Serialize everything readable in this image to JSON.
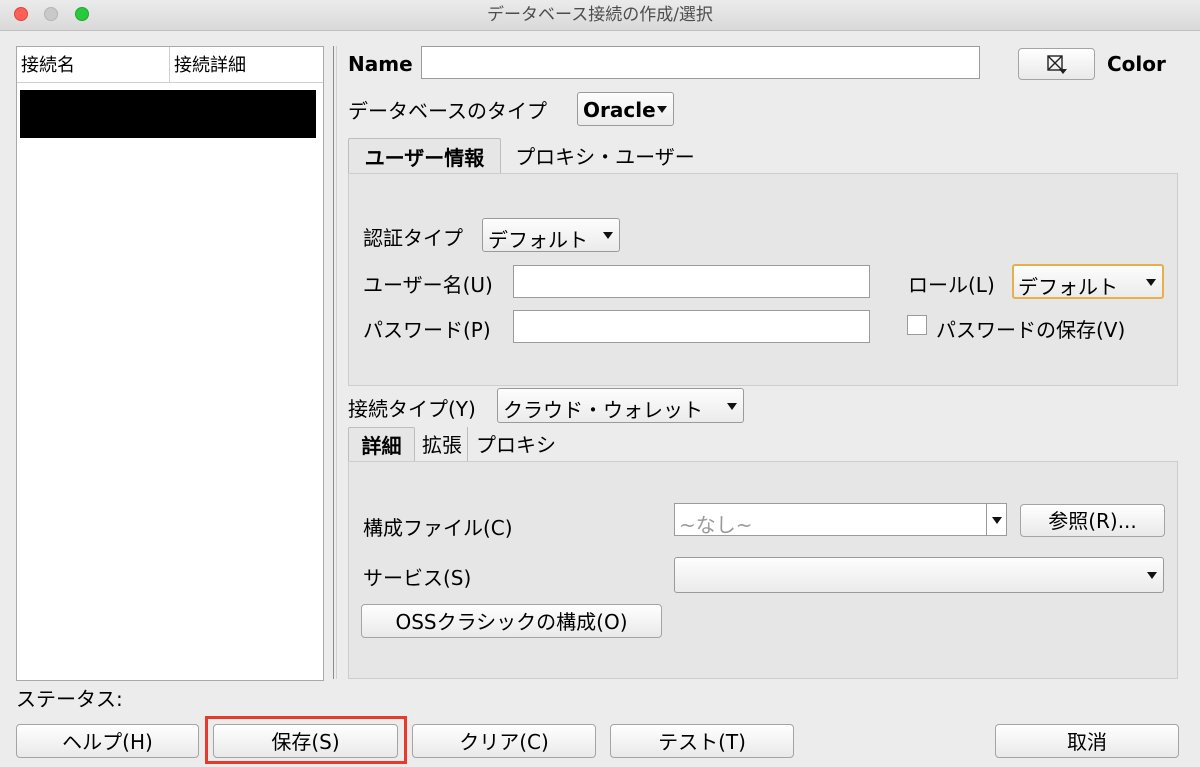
{
  "window": {
    "title": "データベース接続の作成/選択"
  },
  "connection_list": {
    "columns": [
      "接続名",
      "接続詳細"
    ]
  },
  "form": {
    "name_label": "Name",
    "name_value": "",
    "color_label": "Color",
    "color_icon": "color-picker-icon",
    "db_type_label": "データベースのタイプ",
    "db_type_value": "Oracle",
    "user_tabs": [
      "ユーザー情報",
      "プロキシ・ユーザー"
    ],
    "auth_type_label": "認証タイプ",
    "auth_type_value": "デフォルト",
    "username_label": "ユーザー名(U)",
    "username_value": "",
    "password_label": "パスワード(P)",
    "password_value": "",
    "role_label": "ロール(L)",
    "role_value": "デフォルト",
    "save_password_label": "パスワードの保存(V)",
    "save_password_checked": false,
    "conn_type_label": "接続タイプ(Y)",
    "conn_type_value": "クラウド・ウォレット",
    "detail_tabs": [
      "詳細",
      "拡張",
      "プロキシ"
    ],
    "config_file_label": "構成ファイル(C)",
    "config_file_value": "~なし~",
    "browse_button": "参照(R)...",
    "service_label": "サービス(S)",
    "service_value": "",
    "oss_button": "OSSクラシックの構成(O)"
  },
  "status_label": "ステータス:",
  "buttons": {
    "help": "ヘルプ(H)",
    "save": "保存(S)",
    "clear": "クリア(C)",
    "test": "テスト(T)",
    "cancel": "取消"
  },
  "colors": {
    "close": "#fe5f57",
    "minimize": "#c9c9c9",
    "maximize": "#28c840",
    "highlight": "#e8392a",
    "focus_ring": "#e6b04a"
  }
}
